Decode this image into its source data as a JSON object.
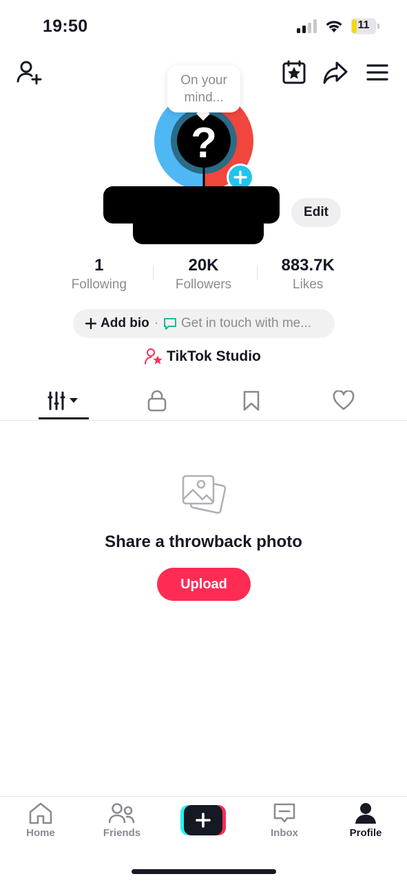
{
  "status_bar": {
    "time": "19:50",
    "battery_level": "11"
  },
  "avatar": {
    "bubble_text": "On your mind..."
  },
  "profile": {
    "edit_label": "Edit"
  },
  "stats": [
    {
      "value": "1",
      "label": "Following"
    },
    {
      "value": "20K",
      "label": "Followers"
    },
    {
      "value": "883.7K",
      "label": "Likes"
    }
  ],
  "bio": {
    "add_label": "Add bio",
    "separator": "·",
    "contact_label": "Get in touch with me..."
  },
  "studio": {
    "label": "TikTok Studio"
  },
  "tabs": [
    {
      "icon": "videos-grid-icon",
      "active": true
    },
    {
      "icon": "lock-icon",
      "active": false
    },
    {
      "icon": "bookmark-icon",
      "active": false
    },
    {
      "icon": "heart-icon",
      "active": false
    }
  ],
  "empty_state": {
    "title": "Share a throwback photo",
    "button": "Upload"
  },
  "bottom_nav": [
    {
      "label": "Home",
      "icon": "home-icon"
    },
    {
      "label": "Friends",
      "icon": "friends-icon"
    },
    {
      "label": "",
      "icon": "create-plus-icon"
    },
    {
      "label": "Inbox",
      "icon": "inbox-icon"
    },
    {
      "label": "Profile",
      "icon": "profile-icon",
      "active": true
    }
  ],
  "colors": {
    "accent": "#fe2c55",
    "cyan": "#25f4ee",
    "text": "#161823",
    "muted": "#8a8b91"
  }
}
